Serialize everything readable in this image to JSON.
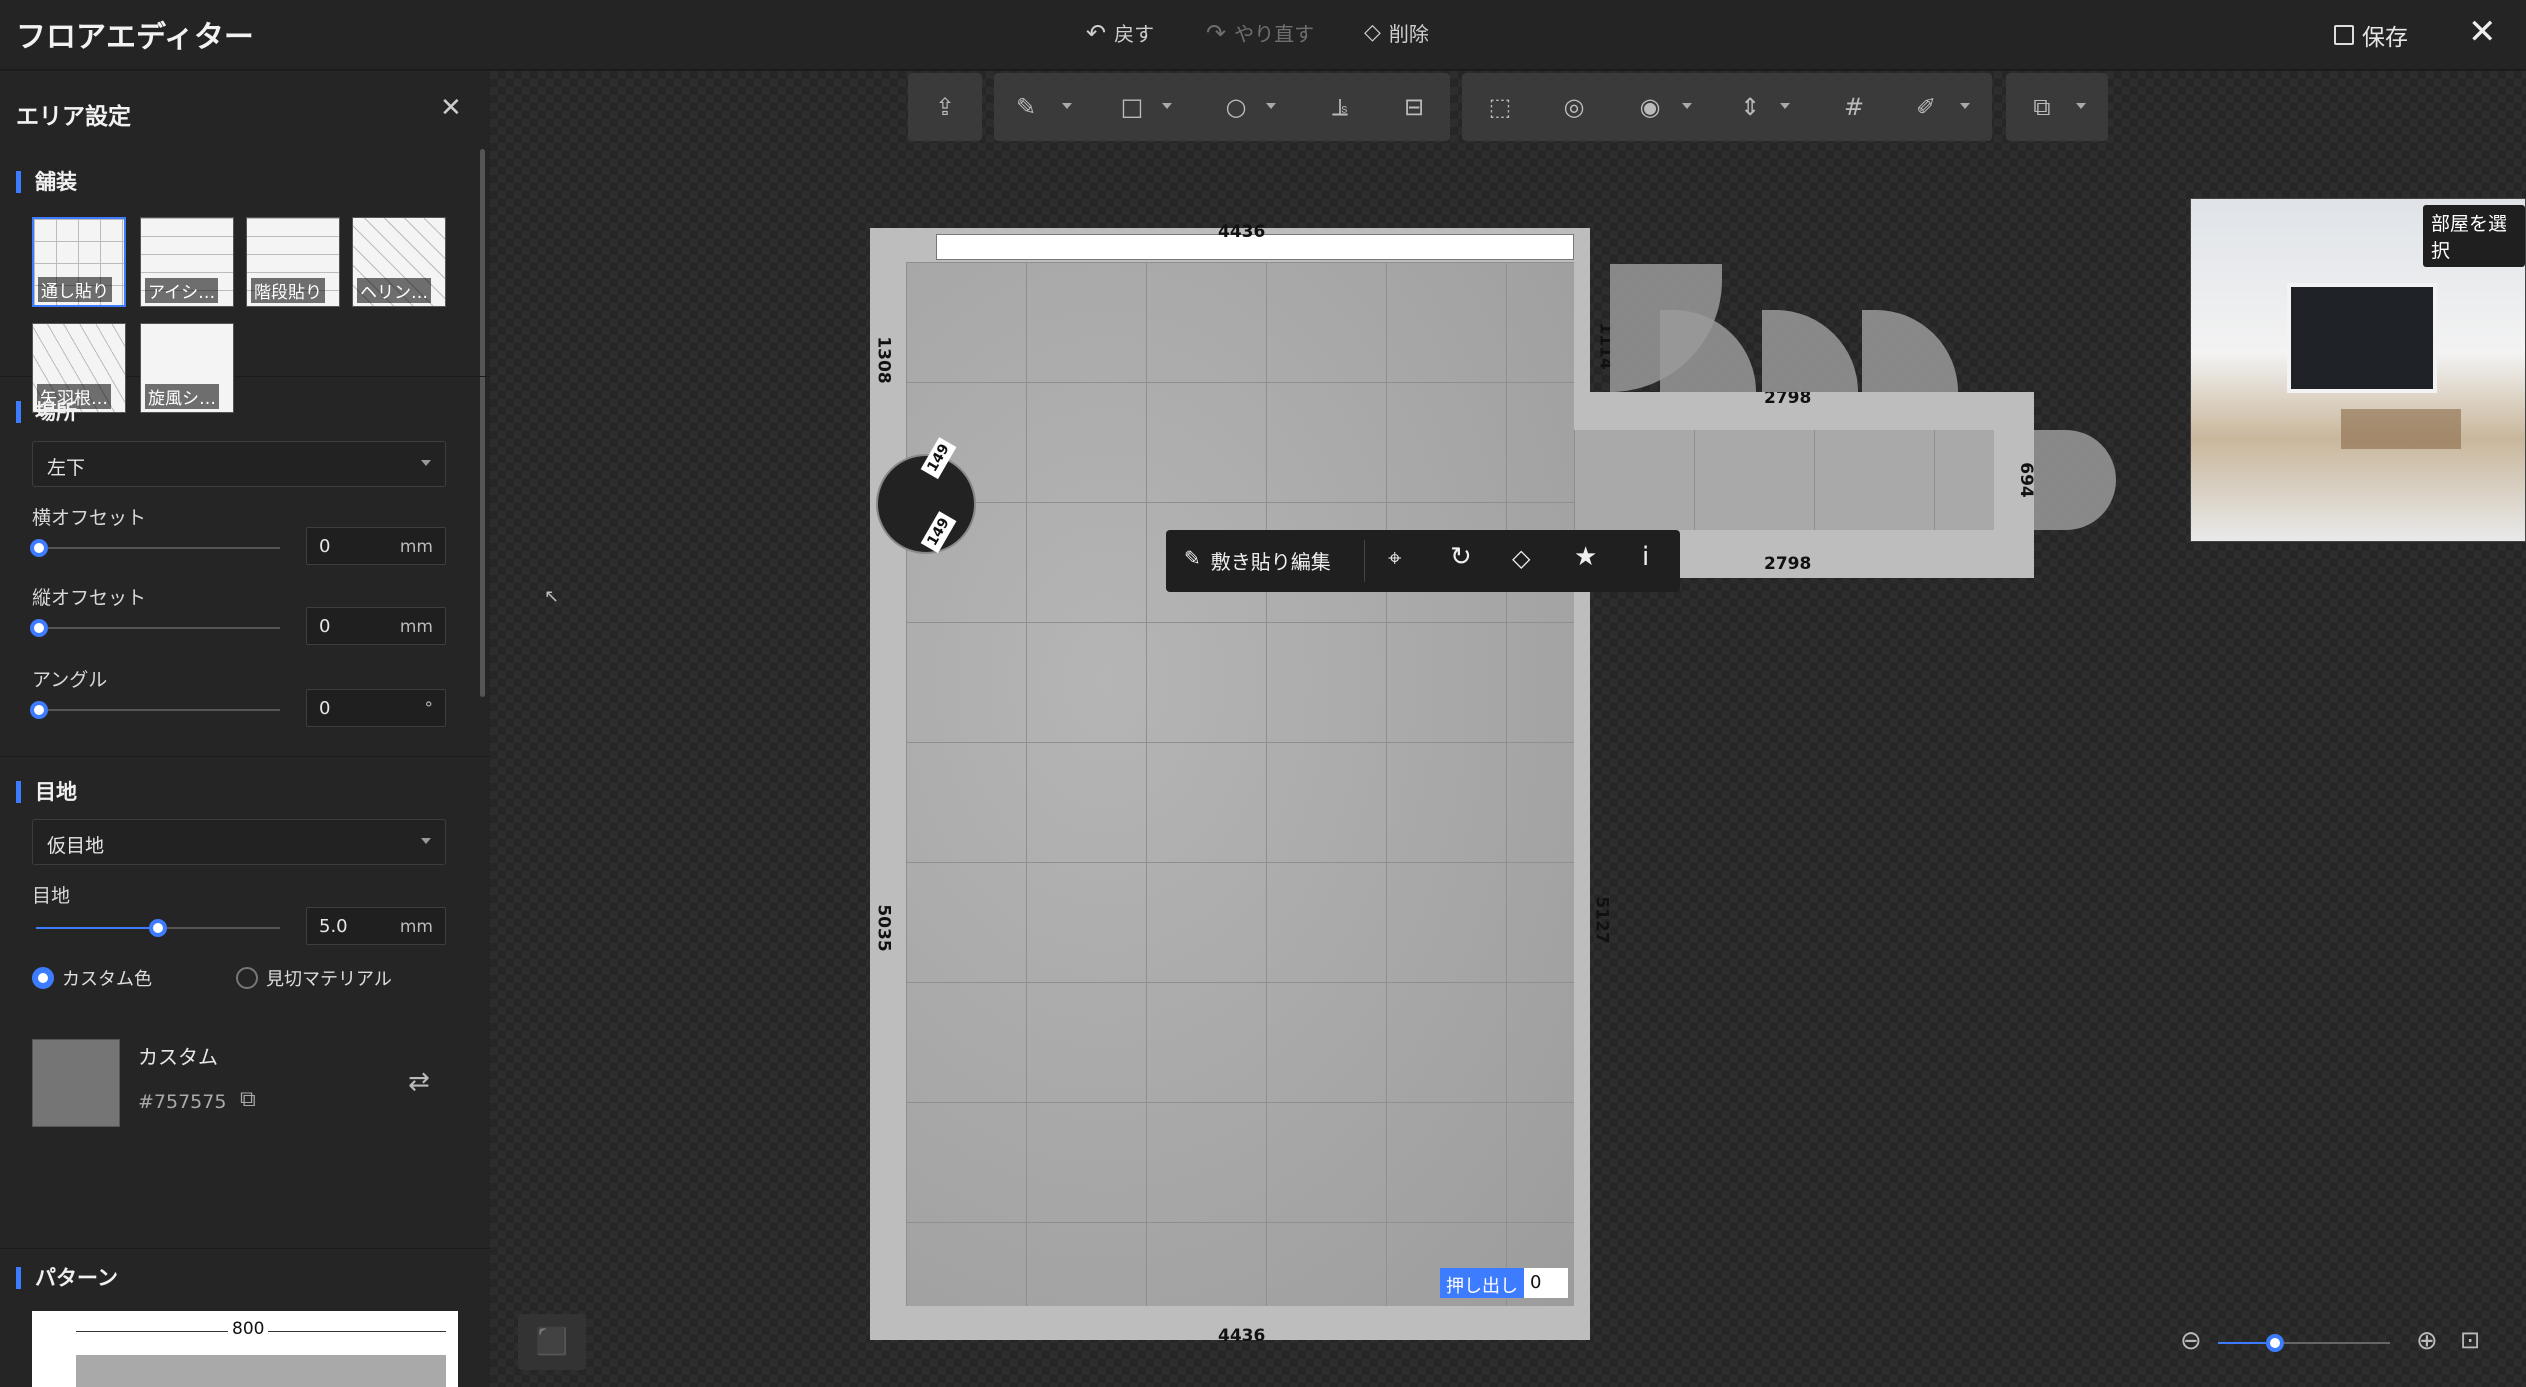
{
  "app": {
    "title": "フロアエディター"
  },
  "top": {
    "undo": "戻す",
    "redo": "やり直す",
    "delete": "削除",
    "save": "保存"
  },
  "panel": {
    "title": "エリア設定",
    "paving": {
      "title": "舗装",
      "tiles": [
        {
          "label": "通し貼り"
        },
        {
          "label": "アイシ…"
        },
        {
          "label": "階段貼り"
        },
        {
          "label": "ヘリン…"
        },
        {
          "label": "矢羽根…"
        },
        {
          "label": "旋風シ…"
        }
      ]
    },
    "place": {
      "title": "場所",
      "position": "左下",
      "h_offset_label": "横オフセット",
      "h_offset": "0",
      "h_unit": "mm",
      "v_offset_label": "縦オフセット",
      "v_offset": "0",
      "v_unit": "mm",
      "angle_label": "アングル",
      "angle": "0",
      "angle_unit": "°",
      "h_offset_level": 0,
      "v_offset_level": 0,
      "angle_level": 0
    },
    "joint": {
      "title": "目地",
      "type": "仮目地",
      "width_label": "目地",
      "width": "5.0",
      "width_unit": "mm",
      "width_level": 0.5,
      "radio_custom": "カスタム色",
      "radio_material": "見切マテリアル",
      "color_name": "カスタム",
      "color_hex": "#757575"
    },
    "pattern": {
      "title": "パターン",
      "dim": "800"
    }
  },
  "canvas": {
    "dims": {
      "top": "4436",
      "bottom": "4436",
      "left_top": "1308",
      "left_main": "5035",
      "right_main": "5127",
      "corridor_top": "2798",
      "corridor_bottom": "2798",
      "door_v": "1114",
      "right_v": "694",
      "circle1": "149",
      "circle2": "149"
    },
    "ctx": {
      "edit": "敷き貼り編集"
    },
    "extrude": {
      "label": "押し出し",
      "value": "0"
    },
    "preview_label": "部屋を選択"
  },
  "colors": {
    "accent": "#3d7bff",
    "custom_swatch": "#757575"
  }
}
